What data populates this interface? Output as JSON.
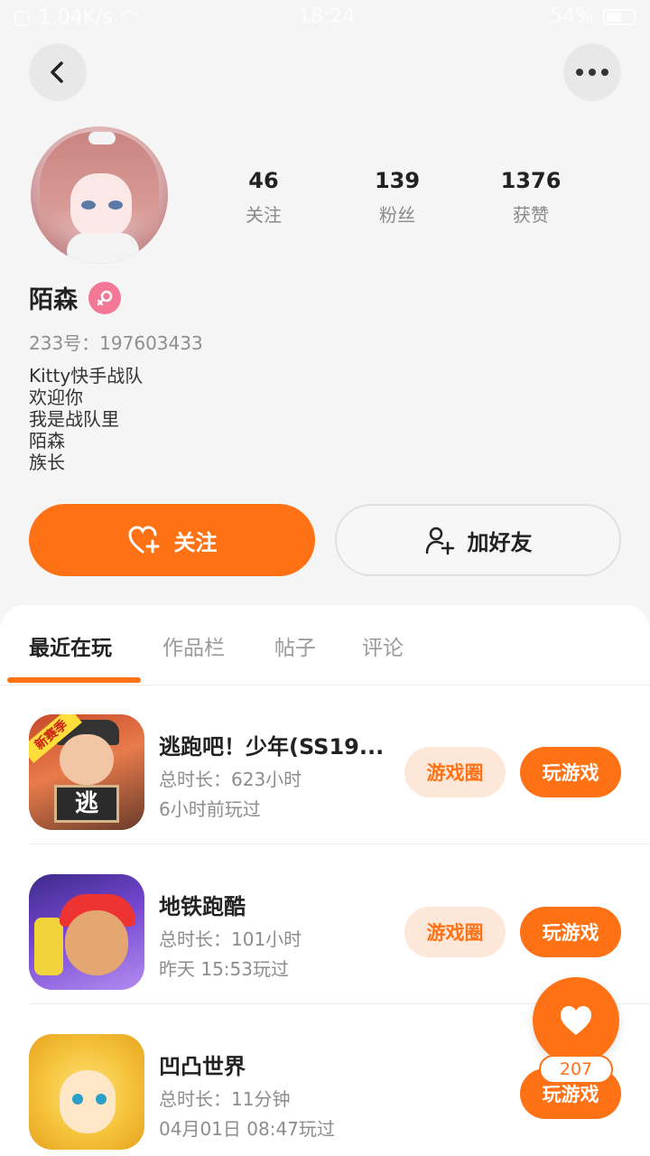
{
  "status_bar": {
    "net_speed": "1.04K/s",
    "time": "18:24",
    "battery": "54%"
  },
  "profile": {
    "name": "陌森",
    "gender_icon": "female-icon",
    "uid_text": "233号：197603433",
    "bio_lines": [
      "Kitty快手战队",
      "欢迎你",
      "我是战队里",
      "陌森",
      "族长"
    ],
    "stats": [
      {
        "num": "46",
        "label": "关注"
      },
      {
        "num": "139",
        "label": "粉丝"
      },
      {
        "num": "1376",
        "label": "获赞"
      }
    ]
  },
  "actions": {
    "follow_label": "关注",
    "add_friend_label": "加好友"
  },
  "tabs": [
    "最近在玩",
    "作品栏",
    "帖子",
    "评论"
  ],
  "games": [
    {
      "title": "逃跑吧！少年(SS19...",
      "duration": "总时长：623小时",
      "last_played": "6小时前玩过",
      "has_circle": true,
      "circle_label": "游戏圈",
      "play_label": "玩游戏",
      "icon_sign": "逃",
      "icon_badge": "新赛季"
    },
    {
      "title": "地铁跑酷",
      "duration": "总时长：101小时",
      "last_played": "昨天 15:53玩过",
      "has_circle": true,
      "circle_label": "游戏圈",
      "play_label": "玩游戏"
    },
    {
      "title": "凹凸世界",
      "duration": "总时长：11分钟",
      "last_played": "04月01日 08:47玩过",
      "has_circle": false,
      "play_label": "玩游戏"
    }
  ],
  "fab": {
    "count": "207"
  },
  "colors": {
    "accent": "#ff7115",
    "accent_light": "#fde7d9",
    "female_badge": "#f27896"
  }
}
